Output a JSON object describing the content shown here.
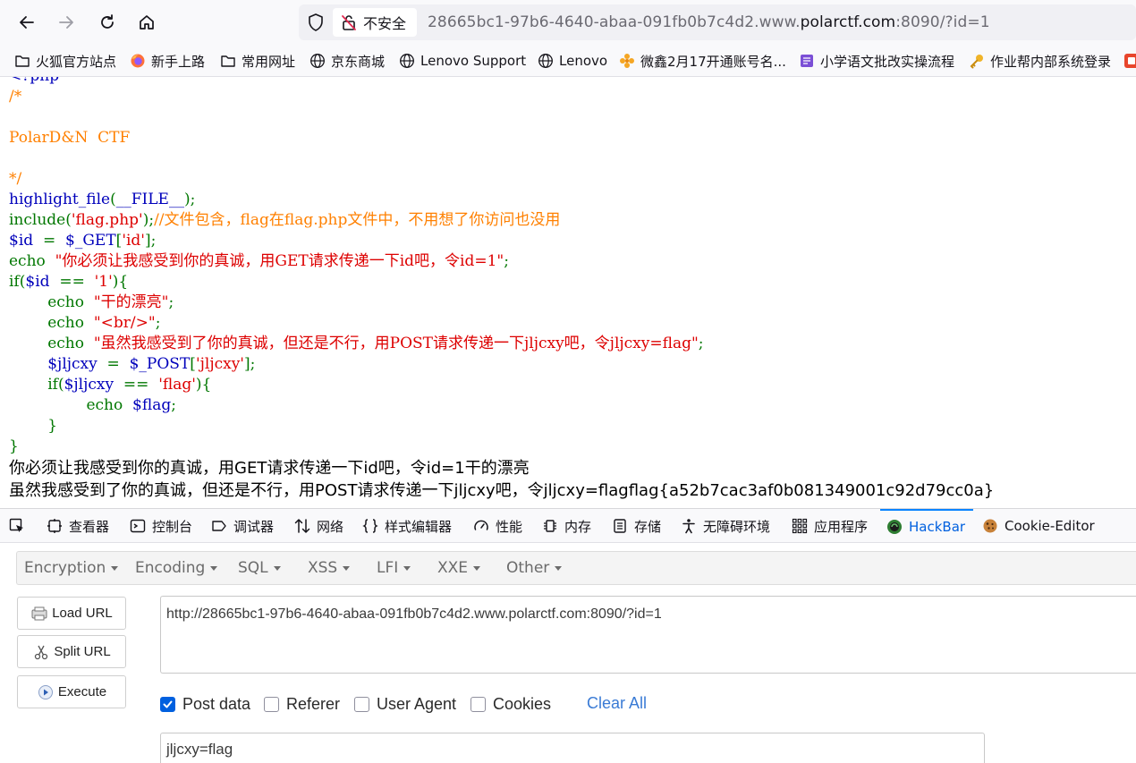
{
  "browser": {
    "security_label": "不安全",
    "url_prefix": "28665bc1-97b6-4640-abaa-091fb0b7c4d2.www.",
    "url_domain": "polarctf.com",
    "url_suffix": ":8090/?id=1"
  },
  "bookmarks": [
    {
      "label": "火狐官方站点",
      "icon": "folder-icon"
    },
    {
      "label": "新手上路",
      "icon": "firefox-icon"
    },
    {
      "label": "常用网址",
      "icon": "folder-icon"
    },
    {
      "label": "京东商城",
      "icon": "globe-icon"
    },
    {
      "label": "Lenovo Support",
      "icon": "globe-icon"
    },
    {
      "label": "Lenovo",
      "icon": "globe-icon"
    },
    {
      "label": "微鑫2月17开通账号名...",
      "icon": "flower-icon"
    },
    {
      "label": "小学语文批改实操流程",
      "icon": "note-icon"
    },
    {
      "label": "作业帮内部系统登录",
      "icon": "key-icon"
    }
  ],
  "code": {
    "l0": "<?php",
    "l1": "/*",
    "l3": "PolarD&N  CTF",
    "l5": "*/",
    "l6_a": "highlight_file",
    "l6_b": "(",
    "l6_c": "__FILE__",
    "l6_d": ");",
    "l7_a": "include(",
    "l7_b": "'flag.php'",
    "l7_c": ");",
    "l7_d": "//文件包含，flag在flag.php文件中，不用想了你访问也没用",
    "l8_a": "$id  ",
    "l8_b": "=  ",
    "l8_c": "$_GET",
    "l8_d": "[",
    "l8_e": "'id'",
    "l8_f": "];",
    "l9_a": "echo  ",
    "l9_b": "\"你必须让我感受到你的真诚，用GET请求传递一下id吧，令id=1\"",
    "l9_c": ";",
    "l10_a": "if(",
    "l10_b": "$id  ",
    "l10_c": "==  ",
    "l10_d": "'1'",
    "l10_e": "){",
    "l11_a": "        echo  ",
    "l11_b": "\"干的漂亮\"",
    "l11_c": ";",
    "l12_a": "        echo  ",
    "l12_b": "\"<br/>\"",
    "l12_c": ";",
    "l13_a": "        echo  ",
    "l13_b": "\"虽然我感受到了你的真诚，但还是不行，用POST请求传递一下jljcxy吧，令jljcxy=flag\"",
    "l13_c": ";",
    "l14_a": "        $jljcxy  ",
    "l14_b": "=  ",
    "l14_c": "$_POST",
    "l14_d": "[",
    "l14_e": "'jljcxy'",
    "l14_f": "];",
    "l15_a": "        if(",
    "l15_b": "$jljcxy  ",
    "l15_c": "==  ",
    "l15_d": "'flag'",
    "l15_e": "){",
    "l16_a": "                echo  ",
    "l16_b": "$flag",
    "l16_c": ";",
    "l17": "        }",
    "l18": "}"
  },
  "output": {
    "line1": "你必须让我感受到你的真诚，用GET请求传递一下id吧，令id=1干的漂亮",
    "line2": "虽然我感受到了你的真诚，但还是不行，用POST请求传递一下jljcxy吧，令jljcxy=flagflag{a52b7cac3af0b081349001c92d79cc0a}"
  },
  "devtools": {
    "tabs": [
      {
        "label": "查看器"
      },
      {
        "label": "控制台"
      },
      {
        "label": "调试器"
      },
      {
        "label": "网络"
      },
      {
        "label": "样式编辑器"
      },
      {
        "label": "性能"
      },
      {
        "label": "内存"
      },
      {
        "label": "存储"
      },
      {
        "label": "无障碍环境"
      },
      {
        "label": "应用程序"
      },
      {
        "label": "HackBar"
      },
      {
        "label": "Cookie-Editor"
      }
    ],
    "active_tab": "HackBar"
  },
  "hackbar": {
    "menu": [
      "Encryption",
      "Encoding",
      "SQL",
      "XSS",
      "LFI",
      "XXE",
      "Other"
    ],
    "load_url": "Load URL",
    "split_url": "Split URL",
    "execute": "Execute",
    "url_value": "http://28665bc1-97b6-4640-abaa-091fb0b7c4d2.www.polarctf.com:8090/?id=1",
    "post_data_label": "Post data",
    "post_data_checked": true,
    "referer_label": "Referer",
    "user_agent_label": "User Agent",
    "cookies_label": "Cookies",
    "clear_all": "Clear All",
    "post_value": "jljcxy=flag"
  },
  "colors": {
    "php_default": "#0000bb",
    "php_comment": "#ff8000",
    "php_keyword": "#007700",
    "php_string": "#dd0000",
    "accent": "#0060df"
  }
}
